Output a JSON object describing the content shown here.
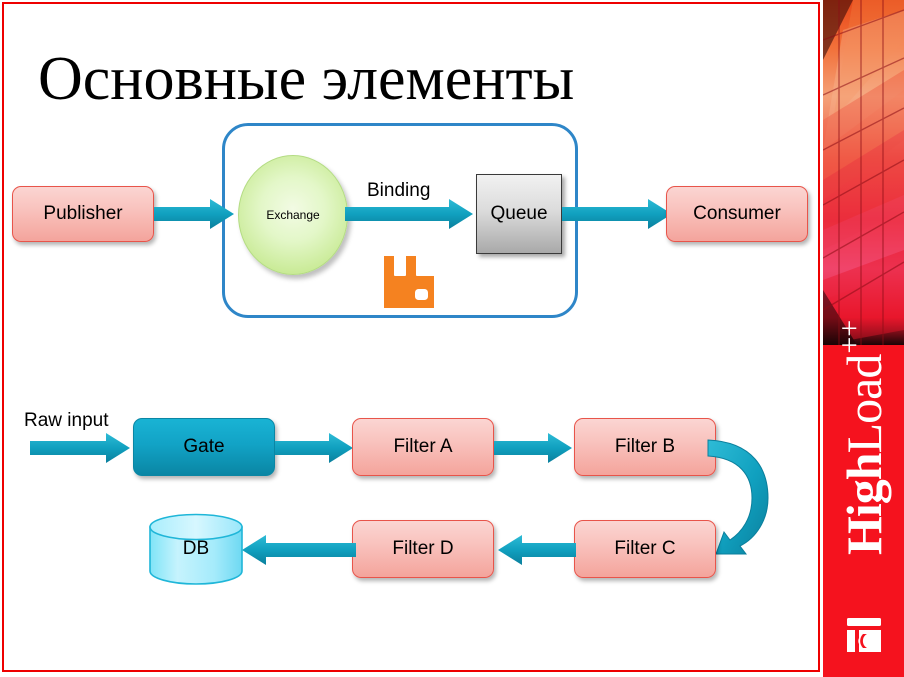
{
  "slide": {
    "title": "Основные элементы",
    "frame_color": "#ee0000",
    "background": "#ffffff"
  },
  "broker_diagram": {
    "container_label": "broker-boundary",
    "container_border_color": "#2e86c8",
    "nodes": [
      {
        "id": "publisher",
        "label": "Publisher",
        "shape": "rounded-rect",
        "style": "pink"
      },
      {
        "id": "exchange",
        "label": "Exchange",
        "shape": "ellipse",
        "style": "green"
      },
      {
        "id": "queue",
        "label": "Queue",
        "shape": "rect",
        "style": "gray"
      },
      {
        "id": "consumer",
        "label": "Consumer",
        "shape": "rounded-rect",
        "style": "pink"
      }
    ],
    "edges": [
      {
        "from": "publisher",
        "to": "exchange",
        "label": ""
      },
      {
        "from": "exchange",
        "to": "queue",
        "label": "Binding"
      },
      {
        "from": "queue",
        "to": "consumer",
        "label": ""
      }
    ],
    "edge_label": "Binding",
    "logo": {
      "name": "rabbitmq-logo",
      "color": "#f58220"
    },
    "arrow_color": "#10a0bf"
  },
  "pipeline_diagram": {
    "input_label": "Raw input",
    "nodes": [
      {
        "id": "gate",
        "label": "Gate",
        "style": "teal"
      },
      {
        "id": "filter-a",
        "label": "Filter A",
        "style": "pink"
      },
      {
        "id": "filter-b",
        "label": "Filter B",
        "style": "pink"
      },
      {
        "id": "filter-c",
        "label": "Filter C",
        "style": "pink"
      },
      {
        "id": "filter-d",
        "label": "Filter D",
        "style": "pink"
      },
      {
        "id": "db",
        "label": "DB",
        "style": "cylinder"
      }
    ],
    "arrow_color": "#10a0bf",
    "db_fill": "#b5f0fb"
  },
  "branding": {
    "panel_color": "#f5121e",
    "logo_high": "High",
    "logo_load": "Load",
    "logo_plus": "++",
    "mark_name": "highload-mark-icon"
  }
}
